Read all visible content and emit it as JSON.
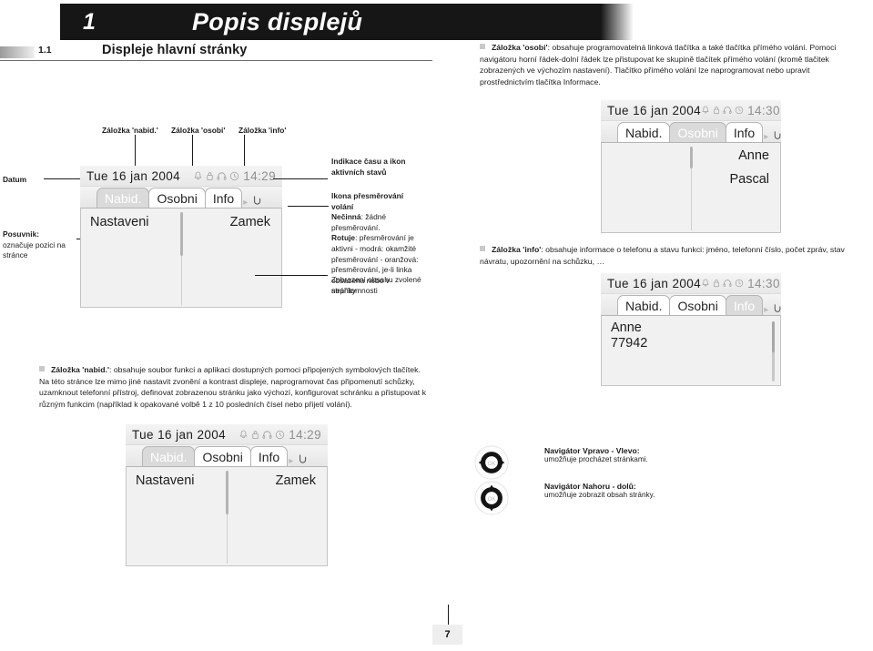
{
  "header": {
    "chapter_number": "1",
    "title": "Popis displejů"
  },
  "section": {
    "number": "1.1",
    "name": "Displeje hlavní stránky"
  },
  "paragraphs": {
    "osobi": {
      "lead": "Záložka 'osobi'",
      "text": ": obsahuje programovatelná linková tlačítka a také tlačítka přímého volání. Pomoci navigátoru horní řádek-dolní řádek lze přistupovat ke skupině tlačítek přímého volání (kromě tlačitek zobrazených ve výchozím nastavení). Tlačítko přímého volání lze naprogramovat nebo upravit prostřednictvím tlačítka Informace."
    },
    "info": {
      "lead": "Záložka 'info'",
      "text": ": obsahuje informace o telefonu a stavu funkci: jméno, telefonní číslo, počet zpráv, stav návratu, upozornění na schůzku, …"
    },
    "nabid": {
      "lead": "Záložka 'nabid.'",
      "text": ": obsahuje soubor funkci a aplikaci dostupných pomoci připojených symbolových tlačítek. Na této stránce lze mimo jiné nastavit zvonění a kontrast displeje, naprogramovat čas připomenutí schůzky, uzamknout telefonní přístroj, definovat zobrazenou stránku jako výchozí, konfigurovat schránku a přistupovat k různým funkcim (například k opakované volbě 1 z 10 posledních čísel nebo přijetí volání)."
    }
  },
  "callouts": {
    "tab_nabid": "Záložka 'nabid.'",
    "tab_osobi": "Záložka 'osobi'",
    "tab_info": "Záložka 'info'",
    "datum": "Datum",
    "posuvnik_title": "Posuvnik:",
    "posuvnik_desc": "označuje pozici na stránce",
    "indikace": "Indikace času a ikon aktivních stavů",
    "ikona_title": "Ikona přesměrování volání",
    "ikona_necinna_label": "Nečinná",
    "ikona_necinna_text": ": žádné přesměrování.",
    "ikona_rotuje_label": "Rotuje",
    "ikona_rotuje_text": ": přesměrování je aktivni - modrá: okamžité přesměrování - oranžová: přesměrování, je-li linka obsazena nebo v nepřítomnosti",
    "zobrazeni": "Zobrazení obsahu zvolené stránky"
  },
  "displays": {
    "main": {
      "date": "Tue 16 jan 2004",
      "time": "14:29",
      "status_icons": [
        "bell-icon",
        "lock-icon",
        "headset-icon",
        "clock-icon"
      ],
      "tabs": [
        {
          "label": "Nabid.",
          "state": "inactive"
        },
        {
          "label": "Osobni",
          "state": "active"
        },
        {
          "label": "Info",
          "state": "active"
        }
      ],
      "left_item": "Nastaveni",
      "right_item": "Zamek"
    },
    "osobi": {
      "date": "Tue 16 jan 2004",
      "time": "14:30",
      "status_icons": [
        "bell-icon",
        "lock-icon",
        "headset-icon",
        "clock-icon"
      ],
      "tabs": [
        {
          "label": "Nabid.",
          "state": "active"
        },
        {
          "label": "Osobni",
          "state": "inactive"
        },
        {
          "label": "Info",
          "state": "active"
        }
      ],
      "right_items": [
        "Anne",
        "Pascal"
      ]
    },
    "info": {
      "date": "Tue 16 jan 2004",
      "time": "14:30",
      "status_icons": [
        "bell-icon",
        "lock-icon",
        "headset-icon",
        "clock-icon"
      ],
      "tabs": [
        {
          "label": "Nabid.",
          "state": "active"
        },
        {
          "label": "Osobni",
          "state": "active"
        },
        {
          "label": "Info",
          "state": "inactive"
        }
      ],
      "lines": [
        "Anne",
        "77942"
      ]
    },
    "bottom": {
      "date": "Tue 16 jan 2004",
      "time": "14:29",
      "status_icons": [
        "bell-icon",
        "lock-icon",
        "headset-icon",
        "clock-icon"
      ],
      "tabs": [
        {
          "label": "Nabid.",
          "state": "inactive"
        },
        {
          "label": "Osobni",
          "state": "active"
        },
        {
          "label": "Info",
          "state": "active"
        }
      ],
      "left_item": "Nastaveni",
      "right_item": "Zamek"
    }
  },
  "navigators": [
    {
      "icon": "navigator-left-right-icon",
      "ok_label": "OK",
      "title": "Navigátor Vpravo - Vlevo:",
      "desc": "umožňuje procházet stránkami."
    },
    {
      "icon": "navigator-up-down-icon",
      "ok_label": "OK",
      "title": "Navigátor Nahoru - dolů:",
      "desc": "umožňuje zobrazit obsah stránky."
    }
  ],
  "footer": {
    "page_number": "7"
  },
  "colors": {
    "header_bg": "#161616",
    "bullet_square": "#c9c9c9",
    "inactive_tab": "#dadada",
    "display_body": "#f1f1f1"
  }
}
